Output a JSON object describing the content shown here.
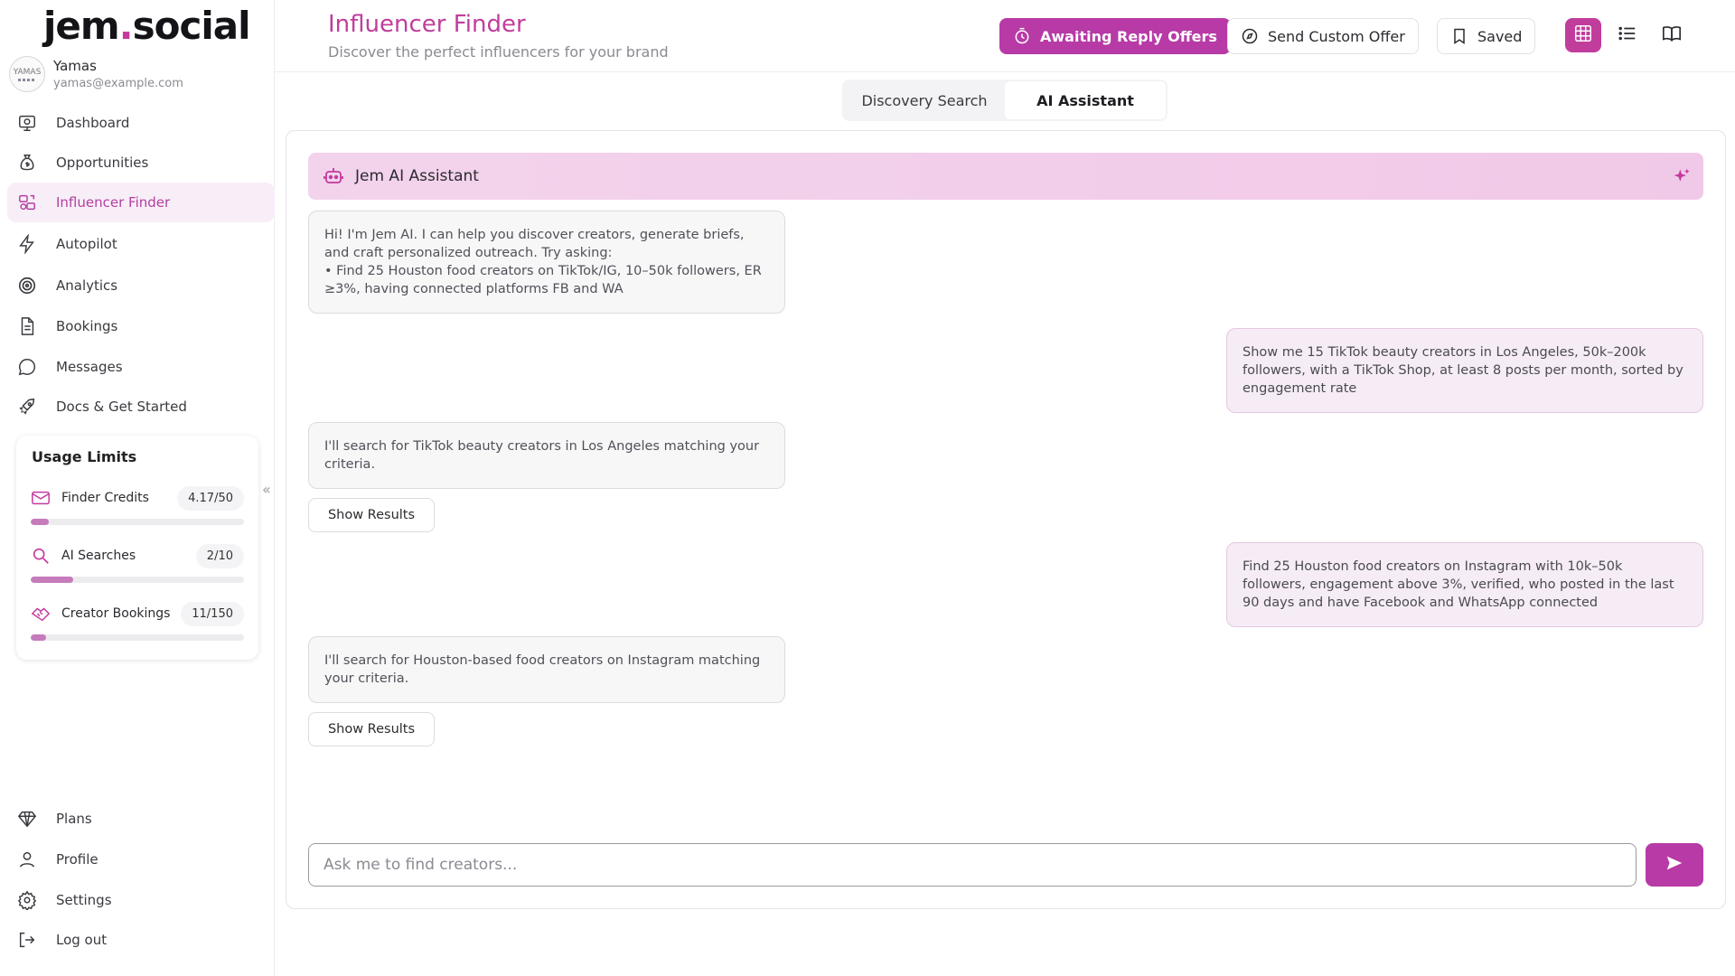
{
  "brand": {
    "name_part1": "jem",
    "dot": ".",
    "name_part2": "social",
    "accent": "#c13d9c"
  },
  "user": {
    "name": "Yamas",
    "email": "yamas@example.com",
    "avatar_text": "YAMAS"
  },
  "sidebar": {
    "items": [
      {
        "label": "Dashboard",
        "icon": "dashboard-icon"
      },
      {
        "label": "Opportunities",
        "icon": "money-bag-icon"
      },
      {
        "label": "Influencer Finder",
        "icon": "influencer-finder-icon",
        "active": true
      },
      {
        "label": "Autopilot",
        "icon": "lightning-icon"
      },
      {
        "label": "Analytics",
        "icon": "target-icon"
      },
      {
        "label": "Bookings",
        "icon": "document-icon"
      },
      {
        "label": "Messages",
        "icon": "chat-bubble-icon"
      },
      {
        "label": "Docs & Get Started",
        "icon": "rocket-icon"
      }
    ],
    "bottom_items": [
      {
        "label": "Plans",
        "icon": "diamond-icon"
      },
      {
        "label": "Profile",
        "icon": "user-icon"
      },
      {
        "label": "Settings",
        "icon": "gear-icon"
      },
      {
        "label": "Log out",
        "icon": "logout-icon"
      }
    ],
    "collapse_glyph": "«"
  },
  "usage": {
    "title": "Usage Limits",
    "rows": [
      {
        "label": "Finder Credits",
        "value": "4.17/50",
        "fraction": 0.0834,
        "icon": "mail-icon"
      },
      {
        "label": "AI Searches",
        "value": "2/10",
        "fraction": 0.2,
        "icon": "search-icon"
      },
      {
        "label": "Creator Bookings",
        "value": "11/150",
        "fraction": 0.0733,
        "icon": "handshake-icon"
      }
    ]
  },
  "header": {
    "title": "Influencer Finder",
    "subtitle": "Discover the perfect influencers for your brand",
    "awaiting_label": "Awaiting Reply Offers",
    "custom_offer_label": "Send Custom Offer",
    "saved_label": "Saved"
  },
  "tabs": {
    "discovery": "Discovery Search",
    "ai": "AI Assistant"
  },
  "chat": {
    "title": "Jem AI Assistant",
    "messages": [
      {
        "role": "bot",
        "text": "Hi! I'm Jem AI. I can help you discover creators, generate briefs, and craft personalized outreach. Try asking:",
        "bullet": "•  Find 25 Houston food creators on TikTok/IG, 10–50k followers, ER ≥3%, having connected platforms FB and WA"
      },
      {
        "role": "user",
        "text": "Show me 15 TikTok beauty creators in Los Angeles, 50k–200k followers, with a TikTok Shop, at least 8 posts per month, sorted by engagement rate"
      },
      {
        "role": "bot",
        "text": "I'll search for TikTok beauty creators in Los Angeles matching your criteria."
      },
      {
        "role": "user",
        "text": "Find 25 Houston food creators on Instagram with 10k–50k followers, engagement above 3%, verified, who posted in the last 90 days and have Facebook and WhatsApp connected"
      },
      {
        "role": "bot",
        "text": "I'll search for Houston-based food creators on Instagram matching your criteria."
      }
    ],
    "show_results_label": "Show Results",
    "input_placeholder": "Ask me to find creators..."
  }
}
